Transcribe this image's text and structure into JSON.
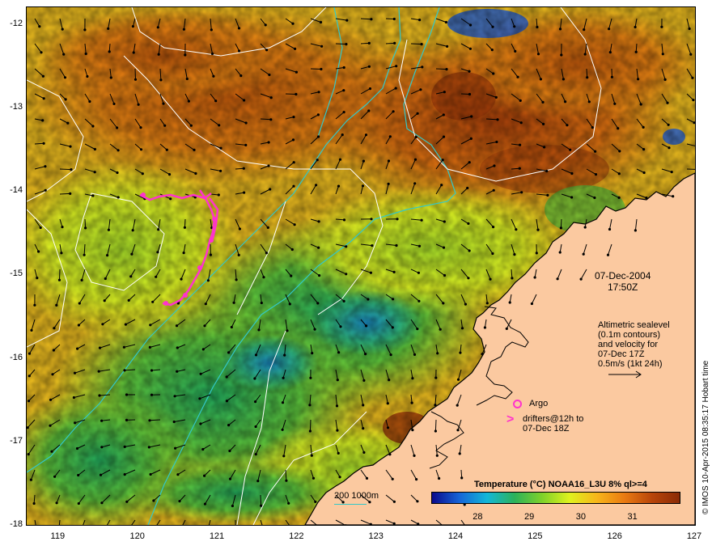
{
  "map": {
    "y_axis_labels": [
      "-12",
      "-13",
      "-14",
      "-15",
      "-16",
      "-17",
      "-18"
    ],
    "x_axis_labels": [
      "119",
      "120",
      "121",
      "122",
      "123",
      "124",
      "125",
      "126",
      "127"
    ],
    "lat_range": [
      -18,
      -11.8
    ],
    "lon_range": [
      118.6,
      127
    ]
  },
  "annotations": {
    "date": "07-Dec-2004",
    "time": "17:50Z",
    "altimetry_lines": [
      "Altimetric sealevel",
      "(0.1m contours)",
      "and velocity for",
      "07-Dec 17Z",
      "0.5m/s (1kt 24h)"
    ],
    "argo_label": "Argo",
    "drifters_line1": "drifters@12h to",
    "drifters_line2": "07-Dec 18Z",
    "isobath_label": "200  1000m",
    "credit": "© IMOS 10-Apr-2015 08:35:17 Hobart time"
  },
  "colorbar": {
    "title": "Temperature (°C) NOAA16_L3U 8% ql>=4",
    "tick_labels": [
      "28",
      "29",
      "30",
      "31"
    ],
    "tick_values": [
      28,
      29,
      30,
      31
    ],
    "range": [
      27.1,
      31.9
    ]
  },
  "colors": {
    "land": "#fbc9a0",
    "coast": "#000000",
    "isobath": "#33c8c8",
    "contour": "#ffffff",
    "argo": "#ff33cc",
    "drifter": "#ff33cc",
    "colormap": [
      "#0a0a8c",
      "#1565d8",
      "#13b7d8",
      "#2cb25a",
      "#7fd12a",
      "#dff21e",
      "#f7b51a",
      "#e97a12",
      "#b8450a",
      "#8a2a05"
    ]
  }
}
